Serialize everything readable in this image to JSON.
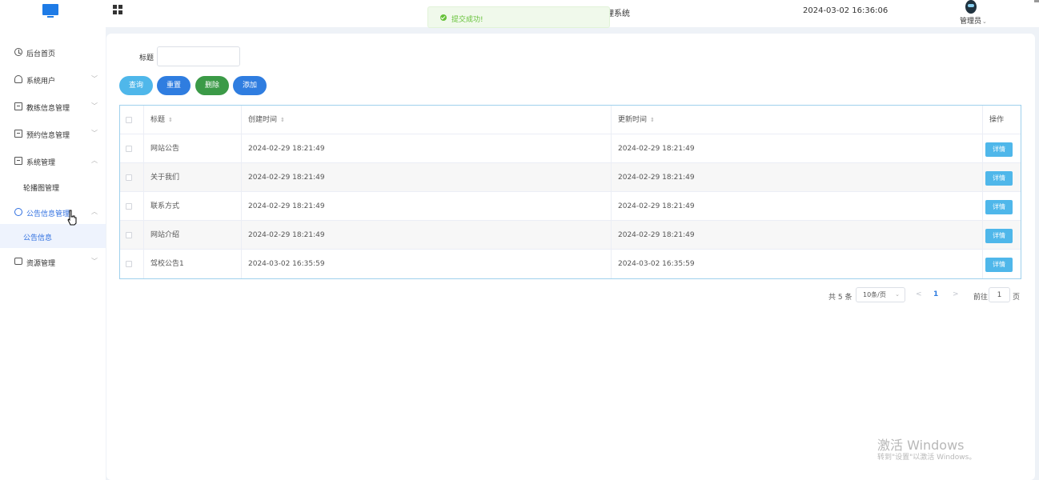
{
  "header": {
    "system_title": "理系统",
    "datetime": "2024-03-02 16:36:06",
    "user_name": "管理员",
    "user_caret": "⌄"
  },
  "toast": {
    "message": "提交成功!",
    "icon": "check-circle-icon",
    "color": "#67c23a"
  },
  "sidebar": {
    "items": [
      {
        "label": "后台首页",
        "icon": "clock-icon",
        "arrow": ""
      },
      {
        "label": "系统用户",
        "icon": "user-icon",
        "arrow": "﹀"
      },
      {
        "label": "教练信息管理",
        "icon": "box-icon",
        "arrow": "﹀"
      },
      {
        "label": "预约信息管理",
        "icon": "box-icon",
        "arrow": "﹀"
      },
      {
        "label": "系统管理",
        "icon": "box-icon",
        "arrow": "︿"
      },
      {
        "label": "公告信息管理",
        "icon": "search-icon",
        "arrow": "︿"
      },
      {
        "label": "资源管理",
        "icon": "stack-icon",
        "arrow": "﹀"
      }
    ],
    "subitems": {
      "system": "轮播图管理",
      "notice": "公告信息"
    },
    "accent_color": "#2f6fe0"
  },
  "search": {
    "label": "标题",
    "value": "",
    "placeholder": ""
  },
  "toolbar": {
    "query": "查询",
    "reset": "重置",
    "delete": "删除",
    "add": "添加"
  },
  "table": {
    "columns": {
      "title": "标题",
      "created": "创建时间",
      "updated": "更新时间",
      "op": "操作"
    },
    "sort_glyph": "⇕",
    "detail_label": "详情",
    "rows": [
      {
        "title": "网站公告",
        "created": "2024-02-29 18:21:49",
        "updated": "2024-02-29 18:21:49"
      },
      {
        "title": "关于我们",
        "created": "2024-02-29 18:21:49",
        "updated": "2024-02-29 18:21:49"
      },
      {
        "title": "联系方式",
        "created": "2024-02-29 18:21:49",
        "updated": "2024-02-29 18:21:49"
      },
      {
        "title": "网站介绍",
        "created": "2024-02-29 18:21:49",
        "updated": "2024-02-29 18:21:49"
      },
      {
        "title": "驾校公告1",
        "created": "2024-03-02 16:35:59",
        "updated": "2024-03-02 16:35:59"
      }
    ]
  },
  "pagination": {
    "total": "共 5 条",
    "page_size": "10条/页",
    "prev": "<",
    "current": "1",
    "next": ">",
    "goto_label": "前往",
    "goto_value": "1",
    "page_suffix": "页"
  },
  "watermark": {
    "title": "激活 Windows",
    "subtitle": "转到\"设置\"以激活 Windows。"
  }
}
